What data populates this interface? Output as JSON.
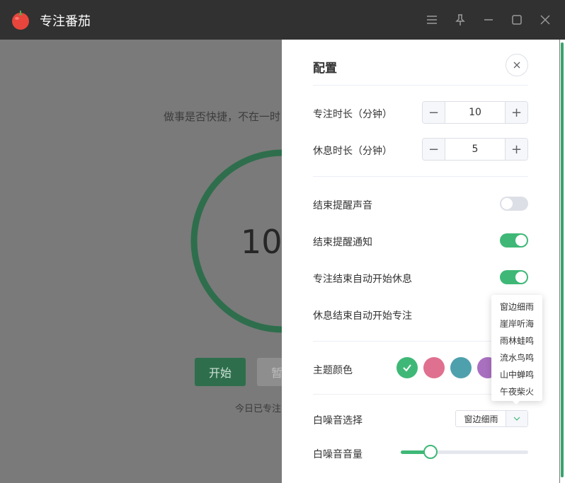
{
  "app": {
    "title": "专注番茄",
    "logo_icon": "tomato-icon",
    "window_buttons": [
      "menu-icon",
      "pin-icon",
      "minimize-icon",
      "maximize-icon",
      "close-icon"
    ]
  },
  "background": {
    "quote": "做事是否快捷，不在一时",
    "timer": "10:",
    "start_label": "开始",
    "pause_label": "暂",
    "today_text": "今日已专注",
    "ring_color": "#2e6e4c"
  },
  "settings": {
    "title": "配置",
    "focus": {
      "label": "专注时长（分钟）",
      "value": "10"
    },
    "rest": {
      "label": "休息时长（分钟）",
      "value": "5"
    },
    "toggles": [
      {
        "label": "结束提醒声音",
        "on": false
      },
      {
        "label": "结束提醒通知",
        "on": true
      },
      {
        "label": "专注结束自动开始休息",
        "on": true
      },
      {
        "label": "休息结束自动开始专注",
        "on": false
      }
    ],
    "theme": {
      "label": "主题颜色",
      "colors": [
        "#3fb877",
        "#e0708f",
        "#4fa0ad",
        "#a970c0"
      ],
      "selected_index": 0
    },
    "noise": {
      "label": "白噪音选择",
      "selected": "窗边细雨",
      "options": [
        "窗边细雨",
        "崖岸听海",
        "雨林蛙鸣",
        "流水鸟鸣",
        "山中蝉鸣",
        "午夜柴火"
      ]
    },
    "volume": {
      "label": "白噪音音量",
      "level": 0.2
    },
    "accent": "#3fb877"
  }
}
